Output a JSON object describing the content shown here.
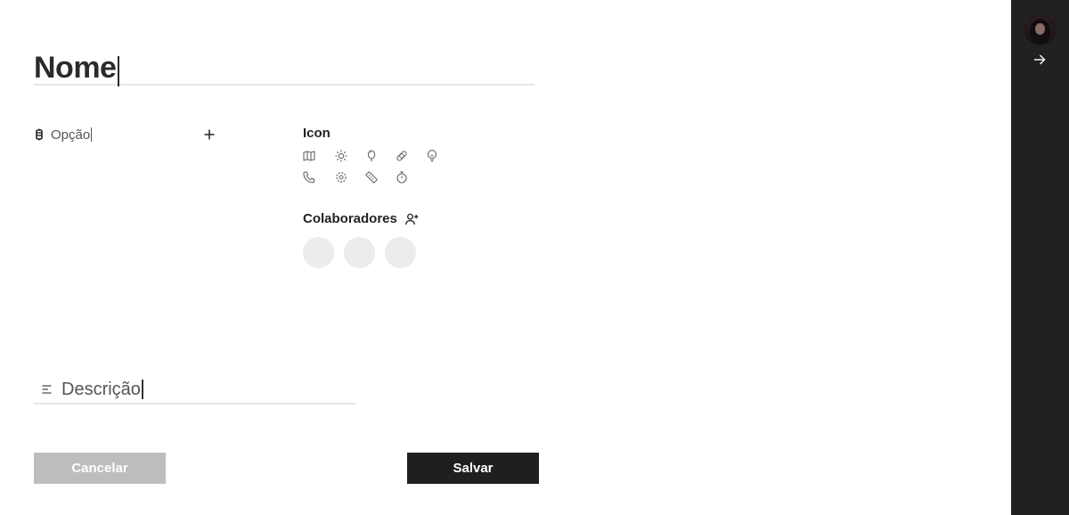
{
  "form": {
    "name_placeholder": "Nome",
    "option_placeholder": "Opção",
    "description_placeholder": "Descrição"
  },
  "icon_section": {
    "title": "Icon",
    "icons": [
      "map-icon",
      "sun-icon",
      "balloon-icon",
      "bandage-icon",
      "lightbulb-icon",
      "phone-icon",
      "gear-icon",
      "ruler-icon",
      "stopwatch-icon"
    ]
  },
  "collaborators": {
    "title": "Colaboradores",
    "slots": 3
  },
  "buttons": {
    "cancel_label": "Cancelar",
    "save_label": "Salvar"
  },
  "colors": {
    "sidebar_bg": "#212121",
    "save_bg": "#1f1f1f",
    "cancel_bg": "#bdbdbd",
    "avatar_placeholder": "#ececec"
  }
}
